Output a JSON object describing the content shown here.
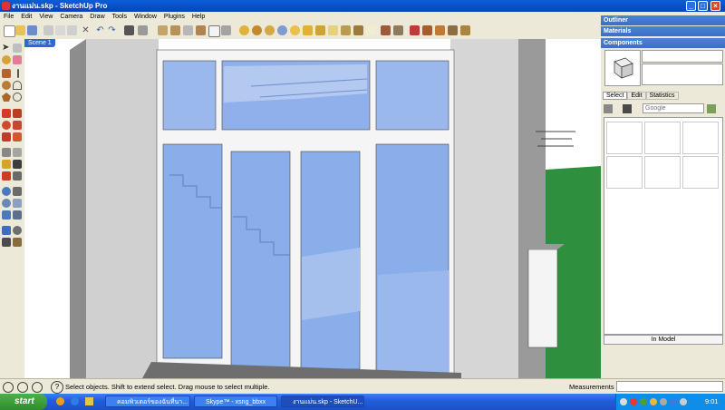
{
  "window": {
    "title": "งานแม่น.skp - SketchUp Pro"
  },
  "menu": [
    "File",
    "Edit",
    "View",
    "Camera",
    "Draw",
    "Tools",
    "Window",
    "Plugins",
    "Help"
  ],
  "scene_tab": "Scene 1",
  "panels": {
    "outliner": "Outliner",
    "materials": "Materials",
    "components": "Components",
    "tabs": [
      "Select",
      "Edit",
      "Statistics"
    ],
    "search_placeholder": "Google",
    "in_model": "In Model"
  },
  "status": {
    "hint": "Select objects. Shift to extend select. Drag mouse to select multiple.",
    "measurements_label": "Measurements"
  },
  "taskbar": {
    "start": "start",
    "tasks": [
      "คอมพิวเตอร์ของฉันที่นา...",
      "Skype™ - xsng_bbxx",
      "งานแม่น.skp - SketchU..."
    ],
    "clock": "9:01"
  },
  "colors": {
    "accent": "#2b6ad2",
    "glass": "#8aaeea",
    "titlebar": "#0a5ed8"
  }
}
